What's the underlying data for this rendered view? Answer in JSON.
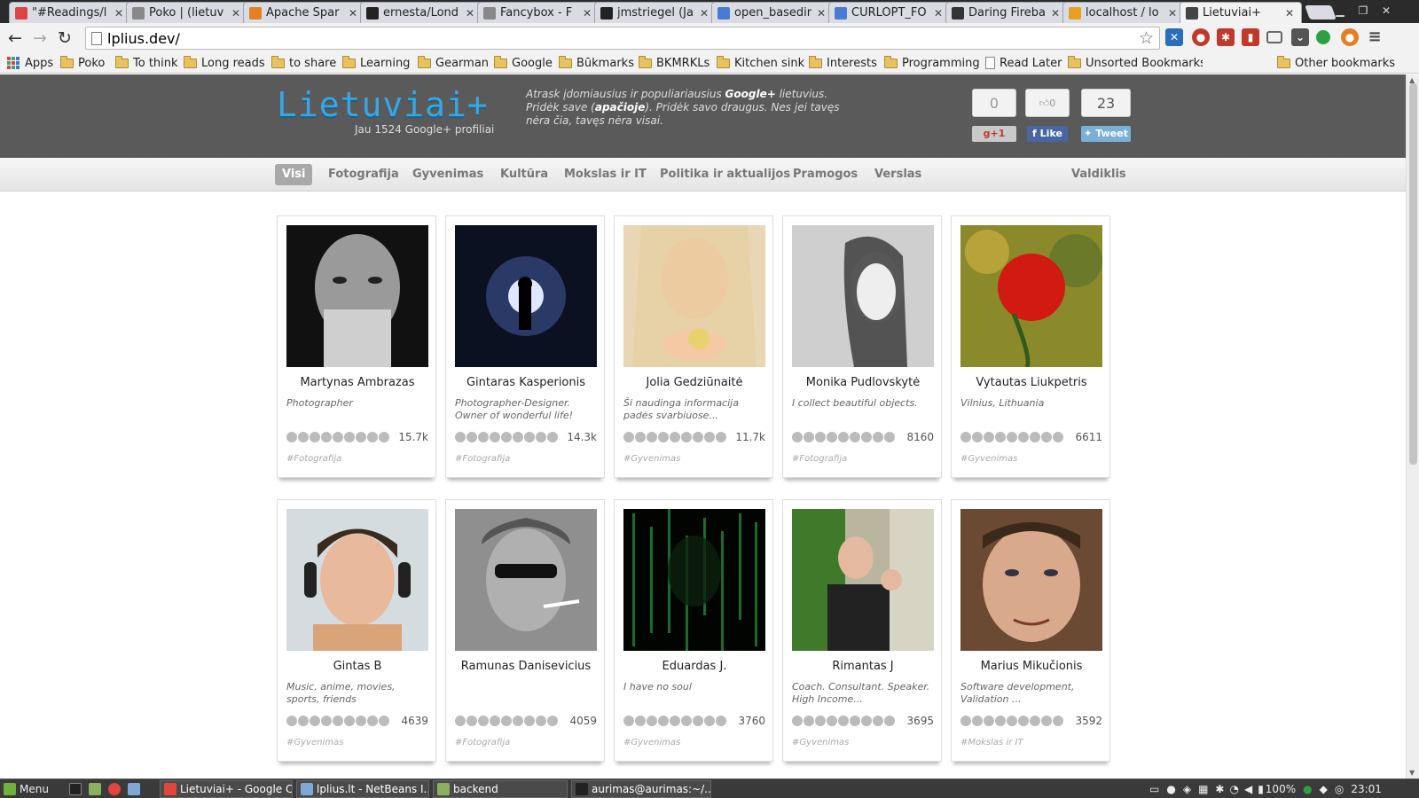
{
  "tabs": [
    {
      "title": "\"#Readings/l",
      "favicon": "gmail-icon",
      "color": "#d44"
    },
    {
      "title": "Poko | (lietuv",
      "favicon": "page-icon",
      "color": "#888"
    },
    {
      "title": "Apache Spar",
      "favicon": "spark-icon",
      "color": "#e67e22"
    },
    {
      "title": "ernesta/Lond",
      "favicon": "github-icon",
      "color": "#222"
    },
    {
      "title": "Fancybox - F",
      "favicon": "page-icon",
      "color": "#888"
    },
    {
      "title": "jmstriegel (Ja",
      "favicon": "github-icon",
      "color": "#222"
    },
    {
      "title": "open_basedir",
      "favicon": "google-icon",
      "color": "#4a7bd4"
    },
    {
      "title": "CURLOPT_FO",
      "favicon": "google-icon",
      "color": "#4a7bd4"
    },
    {
      "title": "Daring Fireba",
      "favicon": "star-icon",
      "color": "#333"
    },
    {
      "title": "localhost / lo",
      "favicon": "phpmyadmin-icon",
      "color": "#e8a020"
    },
    {
      "title": "Lietuviai+",
      "favicon": "lietuviai-icon",
      "color": "#444",
      "active": true
    }
  ],
  "address_bar": {
    "url": "lplius.dev/"
  },
  "bookmarks": [
    {
      "label": "Apps",
      "type": "apps"
    },
    {
      "label": "Poko",
      "type": "folder"
    },
    {
      "label": "To think",
      "type": "folder"
    },
    {
      "label": "Long reads",
      "type": "folder"
    },
    {
      "label": "to share",
      "type": "folder"
    },
    {
      "label": "Learning",
      "type": "folder"
    },
    {
      "label": "Gearman",
      "type": "folder"
    },
    {
      "label": "Google",
      "type": "folder"
    },
    {
      "label": "Būkmarks",
      "type": "folder"
    },
    {
      "label": "BKMRKLs",
      "type": "folder"
    },
    {
      "label": "Kitchen sink",
      "type": "folder"
    },
    {
      "label": "Interests",
      "type": "folder"
    },
    {
      "label": "Programming",
      "type": "folder"
    },
    {
      "label": "Read Later",
      "type": "page"
    },
    {
      "label": "Unsorted Bookmarks",
      "type": "folder"
    }
  ],
  "other_bookmarks": "Other bookmarks",
  "site": {
    "logo": "Lietuviai+",
    "profile_count": "Jau 1524 Google+ profiliai",
    "tagline_1": "Atrask įdomiausius ir populiariausius ",
    "tagline_bold_1": "Google+",
    "tagline_2": " lietuvius. Pridėk save (",
    "tagline_bold_2": "apačioje",
    "tagline_3": "). Pridėk savo draugus. Nes jei tavęs nėra čia, tavęs nėra visai.",
    "gplus_count": "0",
    "like_count": "0",
    "tweet_count": "23",
    "gplus_label": "+1",
    "like_label": "Like",
    "tweet_label": "Tweet"
  },
  "categories": [
    "Visi",
    "Fotografija",
    "Gyvenimas",
    "Kultūra",
    "Mokslas ir IT",
    "Politika ir aktualijos",
    "Pramogos",
    "Verslas"
  ],
  "active_category": "Visi",
  "dashboard_link": "Valdiklis",
  "profiles": [
    {
      "name": "Martynas Ambrazas",
      "bio": "Photographer",
      "followers": "15.7k",
      "tag": "#Fotografija"
    },
    {
      "name": "Gintaras Kasperionis",
      "bio": "Photographer-Designer. Owner of wonderful life!",
      "followers": "14.3k",
      "tag": "#Fotografija"
    },
    {
      "name": "Jolia Gedziūnaitė",
      "bio": "Ši naudinga informacija padės svarbiuose...",
      "followers": "11.7k",
      "tag": "#Gyvenimas"
    },
    {
      "name": "Monika Pudlovskytė",
      "bio": "I collect beautiful objects.",
      "followers": "8160",
      "tag": "#Fotografija"
    },
    {
      "name": "Vytautas Liukpetris",
      "bio": "Vilnius, Lithuania",
      "followers": "6611",
      "tag": "#Gyvenimas"
    },
    {
      "name": "Gintas B",
      "bio": "Music, anime, movies, sports, friends",
      "followers": "4639",
      "tag": "#Gyvenimas"
    },
    {
      "name": "Ramunas Danisevicius",
      "bio": "",
      "followers": "4059",
      "tag": "#Fotografija"
    },
    {
      "name": "Eduardas J.",
      "bio": "I have no soul",
      "followers": "3760",
      "tag": "#Gyvenimas"
    },
    {
      "name": "Rimantas J",
      "bio": "Coach. Consultant. Speaker. High Income...",
      "followers": "3695",
      "tag": "#Gyvenimas"
    },
    {
      "name": "Marius Mikučionis",
      "bio": "Software development, Validation ...",
      "followers": "3592",
      "tag": "#Mokslas ir IT"
    }
  ],
  "taskbar": {
    "menu": "Menu",
    "windows": [
      "Lietuviai+ - Google C...",
      "lplius.lt - NetBeans I...",
      "backend",
      "aurimas@aurimas:~/..."
    ],
    "battery": "100%",
    "clock": "23:01"
  }
}
